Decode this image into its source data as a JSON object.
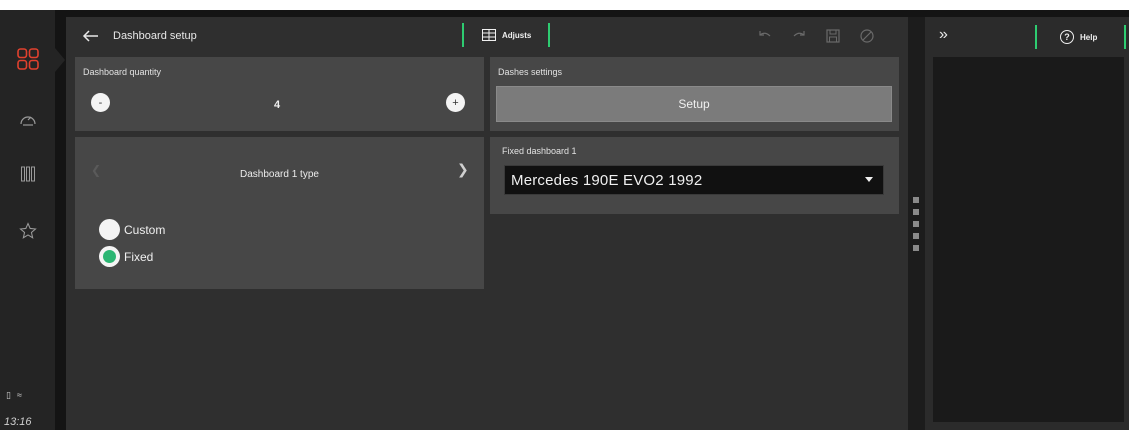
{
  "header": {
    "title": "Dashboard setup",
    "adjusts_label": "Adjusts"
  },
  "sidebar": {
    "items": [
      "dashboard-grid-icon",
      "gauge-icon",
      "columns-icon",
      "star-icon"
    ],
    "time": "13:16"
  },
  "quantity_panel": {
    "label": "Dashboard quantity",
    "value": "4",
    "minus": "-",
    "plus": "+"
  },
  "dashes_panel": {
    "label": "Dashes settings",
    "setup_label": "Setup"
  },
  "type_panel": {
    "title": "Dashboard 1 type",
    "options": [
      {
        "label": "Custom",
        "selected": false
      },
      {
        "label": "Fixed",
        "selected": true
      }
    ]
  },
  "fixed_panel": {
    "label": "Fixed dashboard 1",
    "selected": "Mercedes 190E EVO2 1992"
  },
  "right_panel": {
    "help_label": "Help"
  },
  "colors": {
    "accent": "#2ecc71",
    "brand": "#e2412e",
    "radio_on": "#2bb673"
  }
}
